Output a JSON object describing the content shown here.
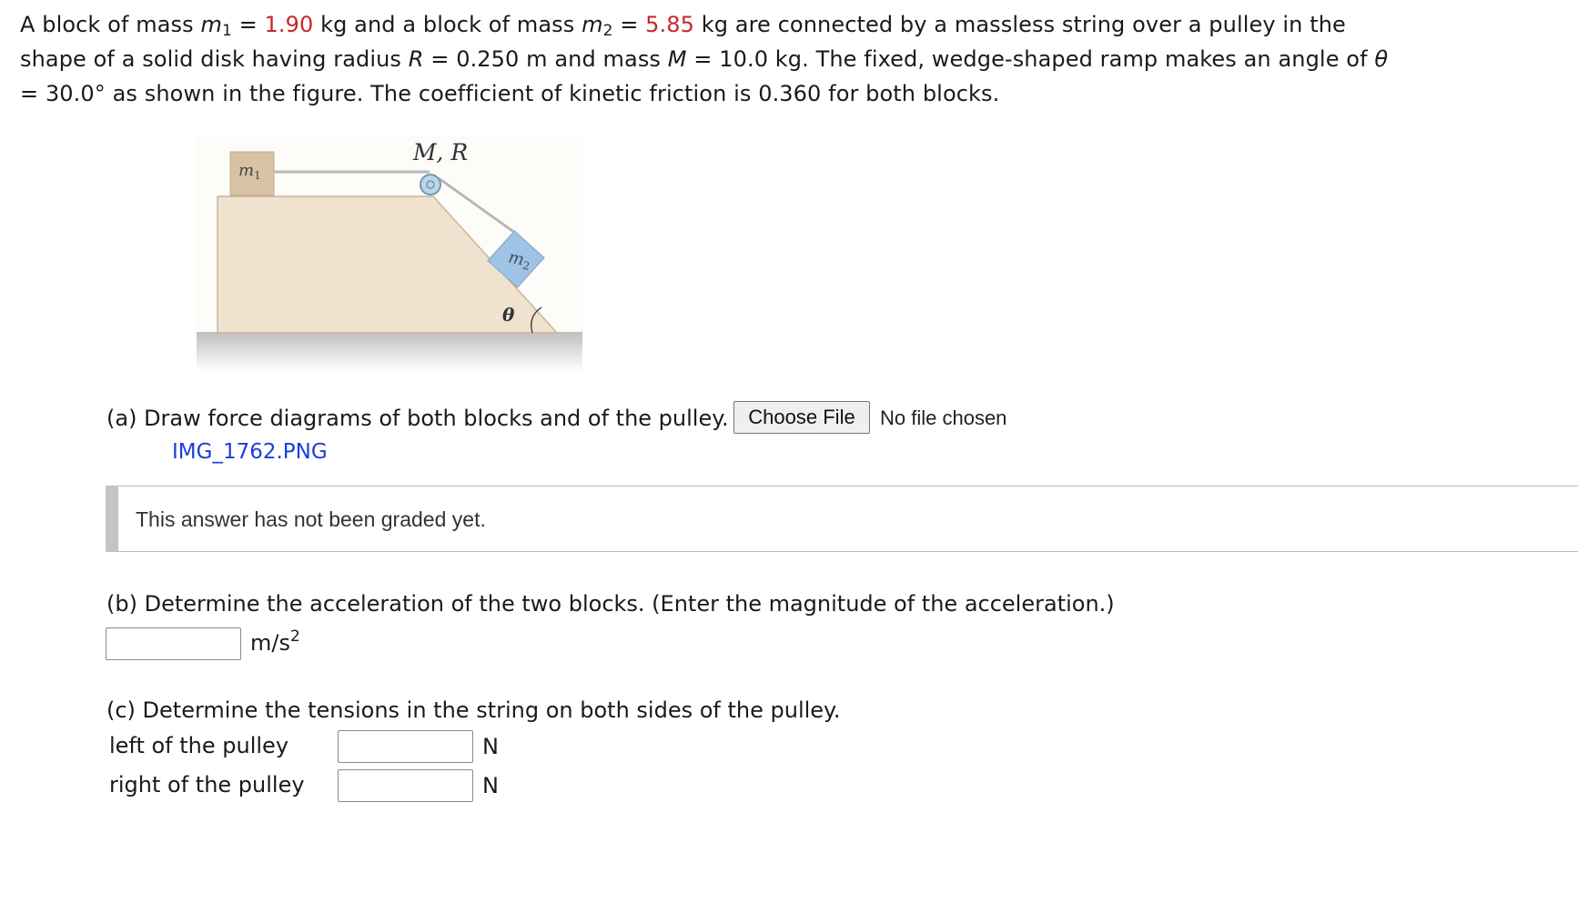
{
  "problem": {
    "t1": "A block of mass ",
    "m1_sym": "m",
    "m1_sub": "1",
    "eq1": " = ",
    "m1_val": "1.90",
    "t2": " kg  and a block of mass ",
    "m2_sym": "m",
    "m2_sub": "2",
    "eq2": " = ",
    "m2_val": "5.85",
    "t3": " kg  are connected by a massless string over a pulley in the shape of a solid disk having radius ",
    "R_sym": "R",
    "t4": " = 0.250 m  and mass ",
    "M_sym": "M",
    "t5": " = 10.0 kg.  The fixed, wedge-shaped ramp makes an angle of ",
    "theta_sym": "θ",
    "t6": " = 30.0°  as shown in the figure. The coefficient of kinetic friction is 0.360 for both blocks."
  },
  "figure": {
    "pulley_label": "M, R",
    "m1_label": "m",
    "m1_sub": "1",
    "m2_label": "m",
    "m2_sub": "2",
    "angle_label": "θ"
  },
  "part_a": {
    "text": "(a) Draw force diagrams of both blocks and of the pulley.",
    "button_label": "Choose File",
    "file_status": "No file chosen",
    "uploaded_file": "IMG_1762.PNG",
    "graded_message": "This answer has not been graded yet."
  },
  "part_b": {
    "text": "(b) Determine the acceleration of the two blocks. (Enter the magnitude of the acceleration.)",
    "unit_base": "m/s",
    "unit_exp": "2"
  },
  "part_c": {
    "text": "(c) Determine the tensions in the string on both sides of the pulley.",
    "left_label": "left of the pulley",
    "right_label": "right of the pulley",
    "left_unit": "N",
    "right_unit": "N"
  },
  "colors": {
    "given_value": "#c62828",
    "link": "#1c3ddb",
    "wedge": "#efe2cf",
    "block1": "#d7c2a4",
    "block2": "#9ec3e4"
  }
}
